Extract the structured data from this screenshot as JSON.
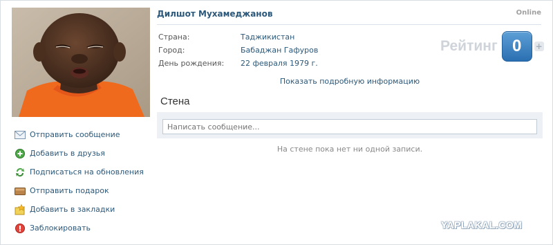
{
  "profile": {
    "name": "Дилшот Мухамеджанов",
    "status": "Online",
    "info": [
      {
        "label": "Страна:",
        "value": "Таджикистан"
      },
      {
        "label": "Город:",
        "value": "Бабаджан Гафуров"
      },
      {
        "label": "День рождения:",
        "value": "22 февраля 1979 г."
      }
    ],
    "more_info_link": "Показать подробную информацию"
  },
  "rating": {
    "label": "Рейтинг",
    "value": "0",
    "plus": "+"
  },
  "actions": [
    {
      "label": "Отправить сообщение",
      "icon": "envelope-icon"
    },
    {
      "label": "Добавить в друзья",
      "icon": "add-friend-icon"
    },
    {
      "label": "Подписаться на обновления",
      "icon": "subscribe-icon"
    },
    {
      "label": "Отправить подарок",
      "icon": "gift-icon"
    },
    {
      "label": "Добавить в закладки",
      "icon": "bookmark-icon"
    },
    {
      "label": "Заблокировать",
      "icon": "block-icon"
    }
  ],
  "wall": {
    "title": "Стена",
    "input_placeholder": "Написать сообщение...",
    "empty_text": "На стене пока нет ни одной записи."
  },
  "watermark": "YAPLAKAL.COM",
  "colors": {
    "link": "#2b587a",
    "rating_badge": "#3a80c2",
    "wall_box": "#edf1f5"
  }
}
